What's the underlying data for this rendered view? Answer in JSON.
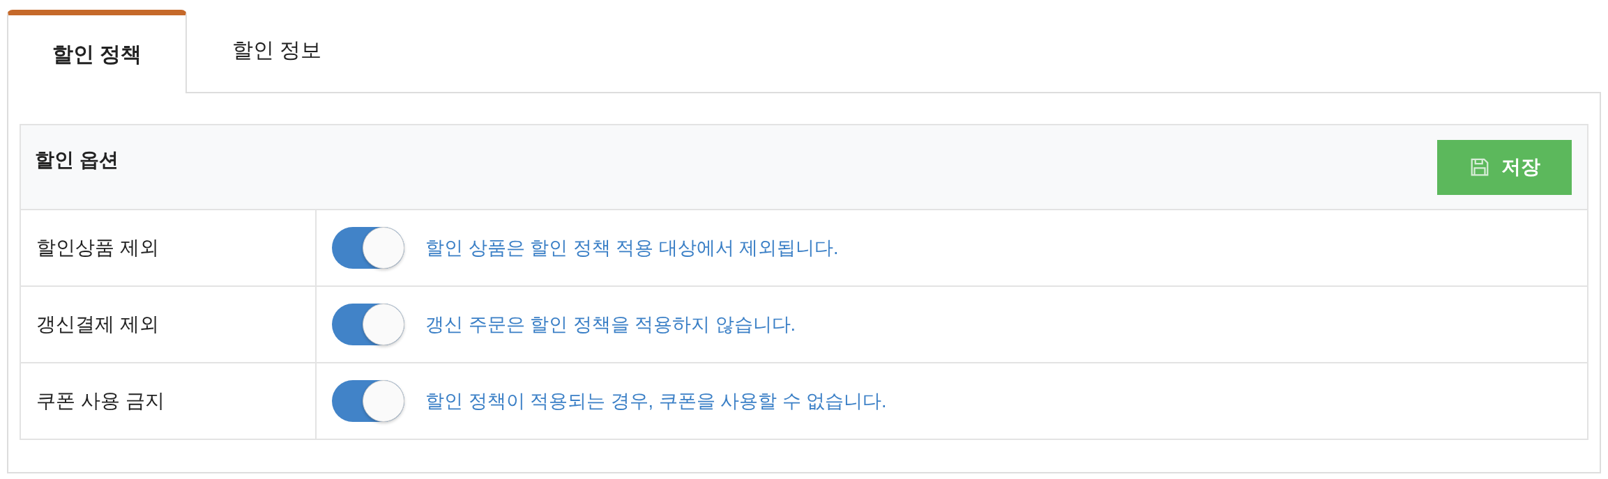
{
  "tabs": [
    {
      "label": "할인 정책",
      "selected": true
    },
    {
      "label": "할인 정보",
      "selected": false
    }
  ],
  "panel": {
    "title": "할인 옵션",
    "save_button": "저장",
    "rows": [
      {
        "label": "할인상품 제외",
        "on": true,
        "description": "할인 상품은 할인 정책 적용 대상에서 제외됩니다."
      },
      {
        "label": "갱신결제 제외",
        "on": true,
        "description": "갱신 주문은 할인 정책을 적용하지 않습니다."
      },
      {
        "label": "쿠폰 사용 금지",
        "on": true,
        "description": "할인 정책이 적용되는 경우, 쿠폰을 사용할 수 없습니다."
      }
    ]
  }
}
